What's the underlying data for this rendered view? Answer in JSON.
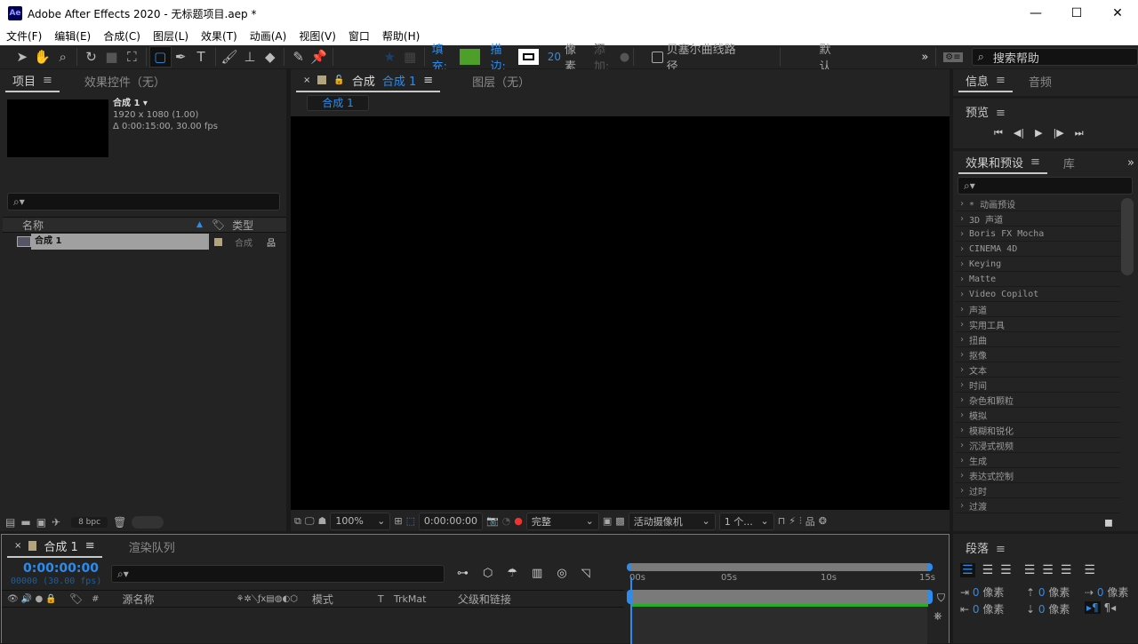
{
  "window": {
    "app_icon": "Ae",
    "title": "Adobe After Effects 2020 - 无标题项目.aep *",
    "minimize": "—",
    "maximize": "☐",
    "close": "✕"
  },
  "menu": [
    "文件(F)",
    "编辑(E)",
    "合成(C)",
    "图层(L)",
    "效果(T)",
    "动画(A)",
    "视图(V)",
    "窗口",
    "帮助(H)"
  ],
  "toolbar": {
    "fill_label": "填充:",
    "stroke_label": "描边:",
    "stroke_width": "20",
    "stroke_unit": "像素",
    "add_label": "添加:",
    "bezier_label": "贝塞尔曲线路径",
    "workspace": "默认",
    "search_placeholder": "搜索帮助",
    "fill_color": "#4e9f2a",
    "accent": "#2d8ceb"
  },
  "project": {
    "tabs": [
      "项目",
      "效果控件（无）"
    ],
    "comp_name": "合成 1",
    "resolution": "1920 x 1080 (1.00)",
    "duration": "Δ 0:00:15:00, 30.00 fps",
    "col_name": "名称",
    "col_type": "类型",
    "items": [
      {
        "name": "合成 1",
        "type": "合成",
        "label_color": "#b3a37e"
      }
    ],
    "bpc": "8 bpc"
  },
  "composition": {
    "tab_prefix": "合成",
    "tab_name": "合成 1",
    "layer_tab": "图层（无）",
    "breadcrumb": "合成 1",
    "zoom": "100%",
    "timecode": "0:00:00:00",
    "resolution": "完整",
    "camera": "活动摄像机",
    "views": "1 个..."
  },
  "info": {
    "tabs": [
      "信息",
      "音频"
    ]
  },
  "preview": {
    "title": "预览",
    "controls": [
      "⏮",
      "◀|",
      "▶",
      "|▶",
      "⏭"
    ]
  },
  "effects": {
    "tabs": [
      "效果和预设",
      "库"
    ],
    "items": [
      "* 动画预设",
      "3D 声道",
      "Boris FX Mocha",
      "CINEMA 4D",
      "Keying",
      "Matte",
      "Video Copilot",
      "声道",
      "实用工具",
      "扭曲",
      "抠像",
      "文本",
      "时间",
      "杂色和颗粒",
      "模拟",
      "模糊和锐化",
      "沉浸式视频",
      "生成",
      "表达式控制",
      "过时",
      "过渡"
    ]
  },
  "timeline": {
    "tabs": [
      "合成 1",
      "渲染队列"
    ],
    "timecode": "0:00:00:00",
    "frames": "00000 (30.00 fps)",
    "columns": [
      "#",
      "源名称",
      "模式",
      "T",
      "TrkMat",
      "父级和链接"
    ],
    "ruler": [
      "00s",
      "05s",
      "10s",
      "15s"
    ]
  },
  "paragraph": {
    "title": "段落",
    "fields": [
      {
        "value": "0",
        "unit": "像素"
      },
      {
        "value": "0",
        "unit": "像素"
      },
      {
        "value": "0",
        "unit": "像素"
      },
      {
        "value": "0",
        "unit": "像素"
      },
      {
        "value": "0",
        "unit": "像素"
      }
    ]
  }
}
